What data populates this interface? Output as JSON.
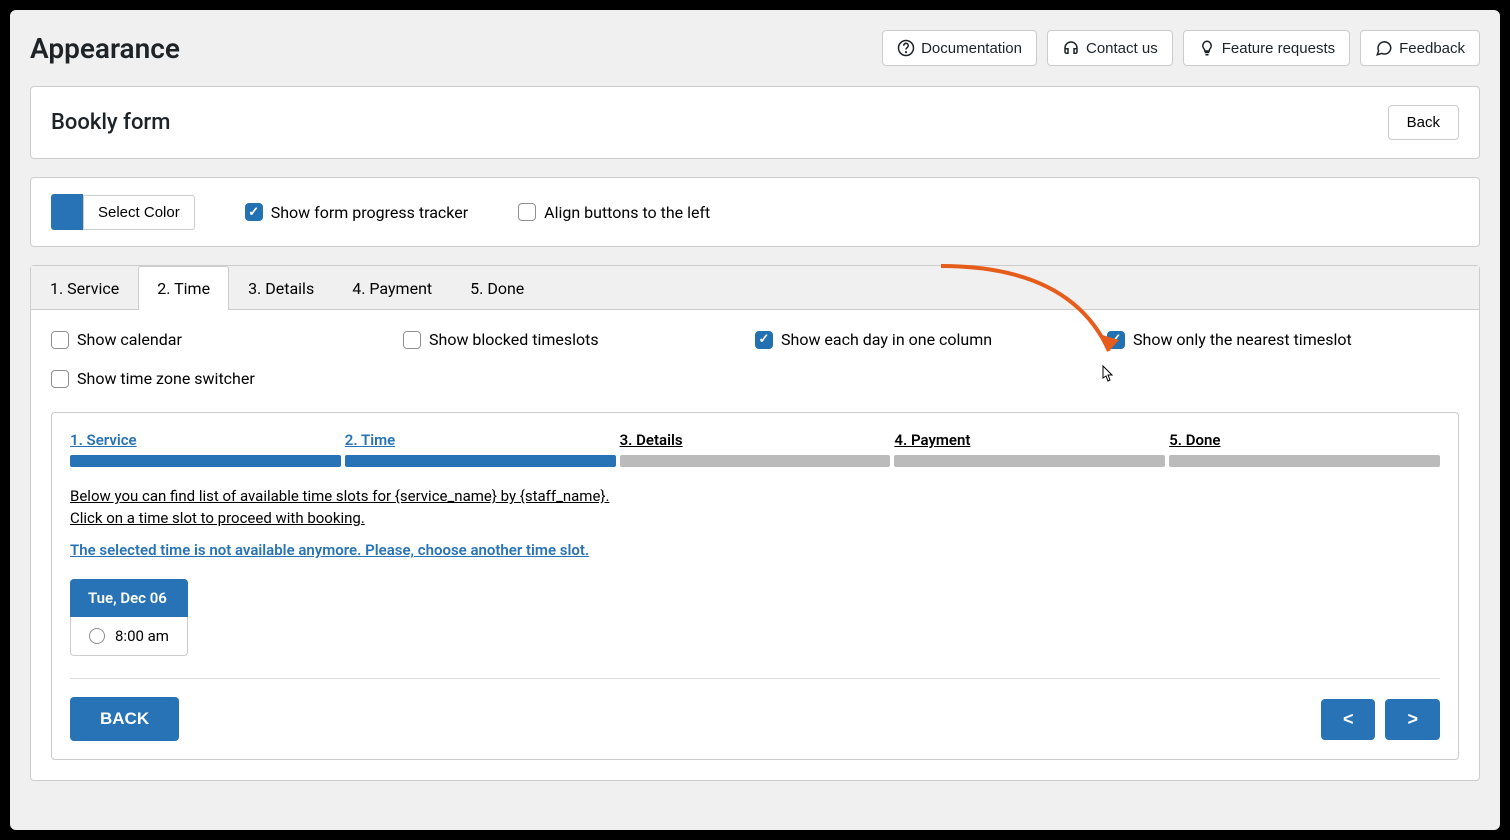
{
  "page_title": "Appearance",
  "header_buttons": {
    "documentation": "Documentation",
    "contact": "Contact us",
    "feature": "Feature requests",
    "feedback": "Feedback"
  },
  "form_card": {
    "title": "Bookly form",
    "back": "Back"
  },
  "select_color": "Select Color",
  "color_value": "#2773b5",
  "top_options": {
    "show_progress": "Show form progress tracker",
    "align_left": "Align buttons to the left"
  },
  "tabs": [
    "1. Service",
    "2. Time",
    "3. Details",
    "4. Payment",
    "5. Done"
  ],
  "active_tab": 1,
  "time_options": {
    "show_calendar": "Show calendar",
    "show_blocked": "Show blocked timeslots",
    "show_each_day": "Show each day in one column",
    "show_nearest": "Show only the nearest timeslot",
    "show_tz": "Show time zone switcher"
  },
  "progress": [
    {
      "label": "1. Service",
      "active": true,
      "filled": true
    },
    {
      "label": "2. Time",
      "active": true,
      "filled": true
    },
    {
      "label": "3. Details",
      "active": false,
      "filled": false
    },
    {
      "label": "4. Payment",
      "active": false,
      "filled": false
    },
    {
      "label": "5. Done",
      "active": false,
      "filled": false
    }
  ],
  "info_line1": "Below you can find list of available time slots for {service_name} by {staff_name}.",
  "info_line2": "Click on a time slot to proceed with booking.",
  "warning": "The selected time is not available anymore. Please, choose another time slot.",
  "slot_day": "Tue, Dec 06",
  "slot_time": "8:00 am",
  "back_btn": "BACK",
  "prev": "<",
  "next": ">"
}
